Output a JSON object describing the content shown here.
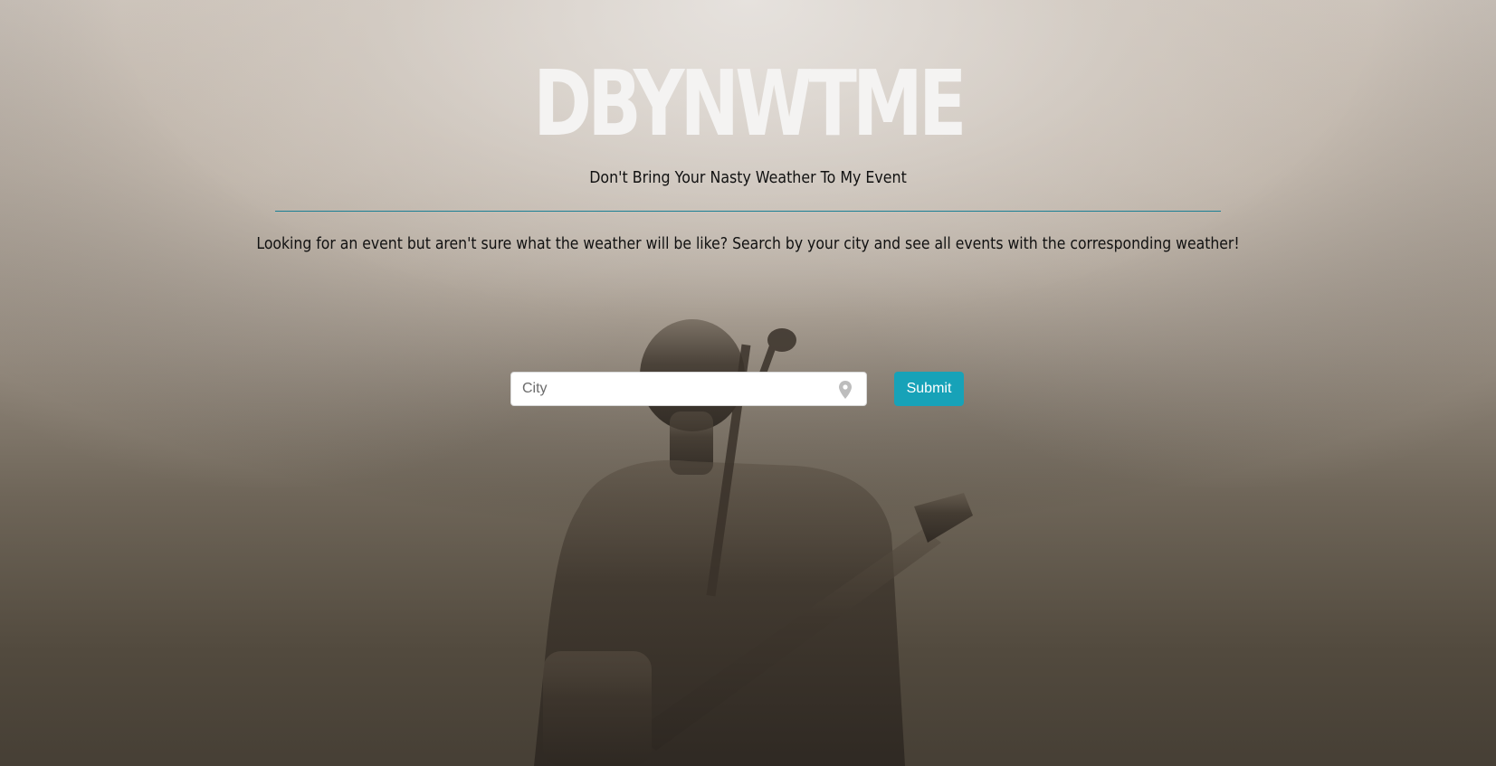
{
  "header": {
    "title": "DBYNWTME",
    "tagline": "Don't Bring Your Nasty Weather To My Event"
  },
  "intro": {
    "description": "Looking for an event but aren't sure what the weather will be like? Search by your city and see all events with the corresponding weather!"
  },
  "search": {
    "placeholder": "City",
    "value": "",
    "icon": "map-pin-icon",
    "submit_label": "Submit"
  },
  "colors": {
    "accent": "#17a2b8",
    "divider": "#1a7f95",
    "title": "#f4f3f2"
  }
}
